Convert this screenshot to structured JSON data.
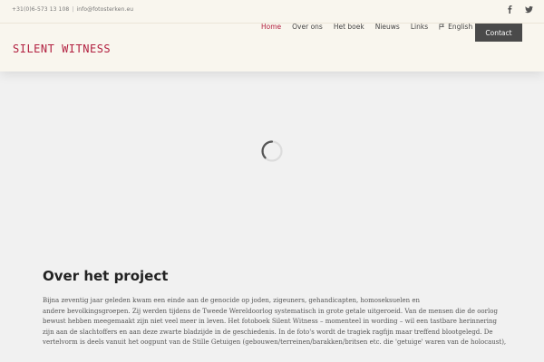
{
  "topbar": {
    "phone": "+31(0)6-573 13 108",
    "separator": "|",
    "email": "info@fotosterken.eu"
  },
  "social": {
    "icons": [
      "facebook-icon",
      "twitter-icon"
    ]
  },
  "logo": "SILENT WITNESS",
  "nav": {
    "items": [
      "Home",
      "Over ons",
      "Het boek",
      "Nieuws",
      "Links"
    ],
    "active": "Home",
    "language": "English",
    "contact": "Contact"
  },
  "colors": {
    "accent": "#b22040",
    "header_bg": "#f9f6ee",
    "page_bg": "#f1f1f1",
    "button_bg": "#4a4a4a"
  },
  "content": {
    "title": "Over het project",
    "lines": [
      "Bijna zeventig jaar geleden kwam een einde aan de genocide op joden, zigeuners, gehandicapten, homoseksuelen en",
      "andere bevolkingsgroepen. Zij werden tijdens de Tweede Wereldoorlog systematisch in grote getale uitgeroeid. Van de mensen die de oorlog",
      "bewust hebben meegemaakt zijn niet veel meer in leven. Het fotoboek Silent Witness – momenteel in wording – wil een tastbare herinnering",
      "zijn aan de slachtoffers en aan deze zwarte bladzijde in de geschiedenis. In de foto's wordt de tragiek ragfijn maar treffend blootgelegd. De",
      "vertelvorm is deels vanuit het oogpunt van de Stille Getuigen (gebouwen/terreinen/barakken/britsen etc. die 'getuige' waren van de holocaust),"
    ]
  }
}
